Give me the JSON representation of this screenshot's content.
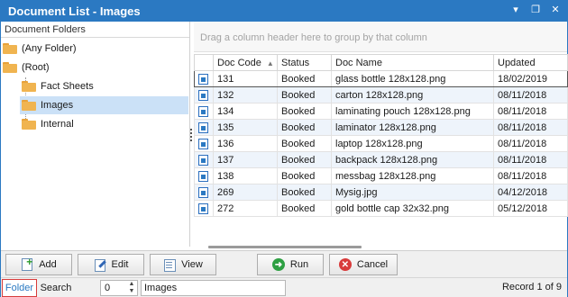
{
  "window": {
    "title": "Document List - Images",
    "controls": [
      "pin-icon",
      "restore-icon",
      "close-icon"
    ]
  },
  "folders": {
    "header": "Document Folders",
    "items": [
      {
        "label": "(Any Folder)",
        "level": 0
      },
      {
        "label": "(Root)",
        "level": 0
      },
      {
        "label": "Fact Sheets",
        "level": 1
      },
      {
        "label": "Images",
        "level": 1,
        "selected": true
      },
      {
        "label": "Internal",
        "level": 1
      }
    ]
  },
  "grid": {
    "group_hint": "Drag a column header here to group by that column",
    "columns": [
      "",
      "Doc Code",
      "Status",
      "Doc Name",
      "Updated"
    ],
    "sort_column": "Doc Code",
    "rows": [
      {
        "code": "131",
        "status": "Booked",
        "name": "glass bottle 128x128.png",
        "updated": "18/02/2019"
      },
      {
        "code": "132",
        "status": "Booked",
        "name": "carton 128x128.png",
        "updated": "08/11/2018"
      },
      {
        "code": "134",
        "status": "Booked",
        "name": "laminating pouch 128x128.png",
        "updated": "08/11/2018"
      },
      {
        "code": "135",
        "status": "Booked",
        "name": "laminator 128x128.png",
        "updated": "08/11/2018"
      },
      {
        "code": "136",
        "status": "Booked",
        "name": "laptop 128x128.png",
        "updated": "08/11/2018"
      },
      {
        "code": "137",
        "status": "Booked",
        "name": "backpack 128x128.png",
        "updated": "08/11/2018"
      },
      {
        "code": "138",
        "status": "Booked",
        "name": "messbag 128x128.png",
        "updated": "08/11/2018"
      },
      {
        "code": "269",
        "status": "Booked",
        "name": "Mysig.jpg",
        "updated": "04/12/2018"
      },
      {
        "code": "272",
        "status": "Booked",
        "name": "gold bottle cap 32x32.png",
        "updated": "05/12/2018"
      }
    ]
  },
  "toolbar": {
    "add": "Add",
    "edit": "Edit",
    "view": "View",
    "run": "Run",
    "cancel": "Cancel"
  },
  "statusbar": {
    "folder_tab": "Folder",
    "search_tab": "Search",
    "spin_value": "0",
    "path": "Images",
    "record": "Record 1 of 9"
  },
  "colors": {
    "accent": "#2b79c2",
    "selected_row": "#cbe1f7",
    "alt_row": "#eef4fb"
  }
}
